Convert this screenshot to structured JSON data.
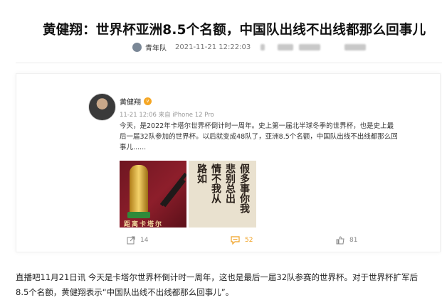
{
  "article": {
    "headline": "黄健翔：世界杯亚洲8.5个名额，中国队出线不出线都那么回事儿",
    "source": "青年队",
    "timestamp": "2021-11-21 12:22:03"
  },
  "weibo_post": {
    "author": "黄健翔",
    "post_meta": "11-21 12:06 来自 iPhone 12 Pro",
    "text": "今天，是2022年卡塔尔世界杯倒计时一周年。史上第一届北半球冬季的世界杯，也是史上最后一届32队参加的世界杯。以后就变成48队了，亚洲8.5个名额，中国队出线不出线都那么回事儿......",
    "image1_caption": "距离卡塔尔",
    "image2_text_cols": [
      "假多事你我",
      "悲别总出",
      "情不我从",
      "路如"
    ],
    "actions": {
      "share_icon": "share-icon",
      "share_count": "14",
      "comment_icon": "comment-icon",
      "comment_count": "52",
      "like_icon": "thumb-up-icon",
      "like_count": "81"
    },
    "colors": {
      "comment_accent": "#f0a020",
      "like_accent": "#888888"
    }
  },
  "body": {
    "line1": "直播吧11月21日讯 今天是卡塔尔世界杯倒计时一周年，这也是最后一届32队参赛的世界杯。对于世界杯扩军后",
    "line2": "8.5个名额，黄健翔表示“中国队出线不出线都那么回事儿”。"
  }
}
